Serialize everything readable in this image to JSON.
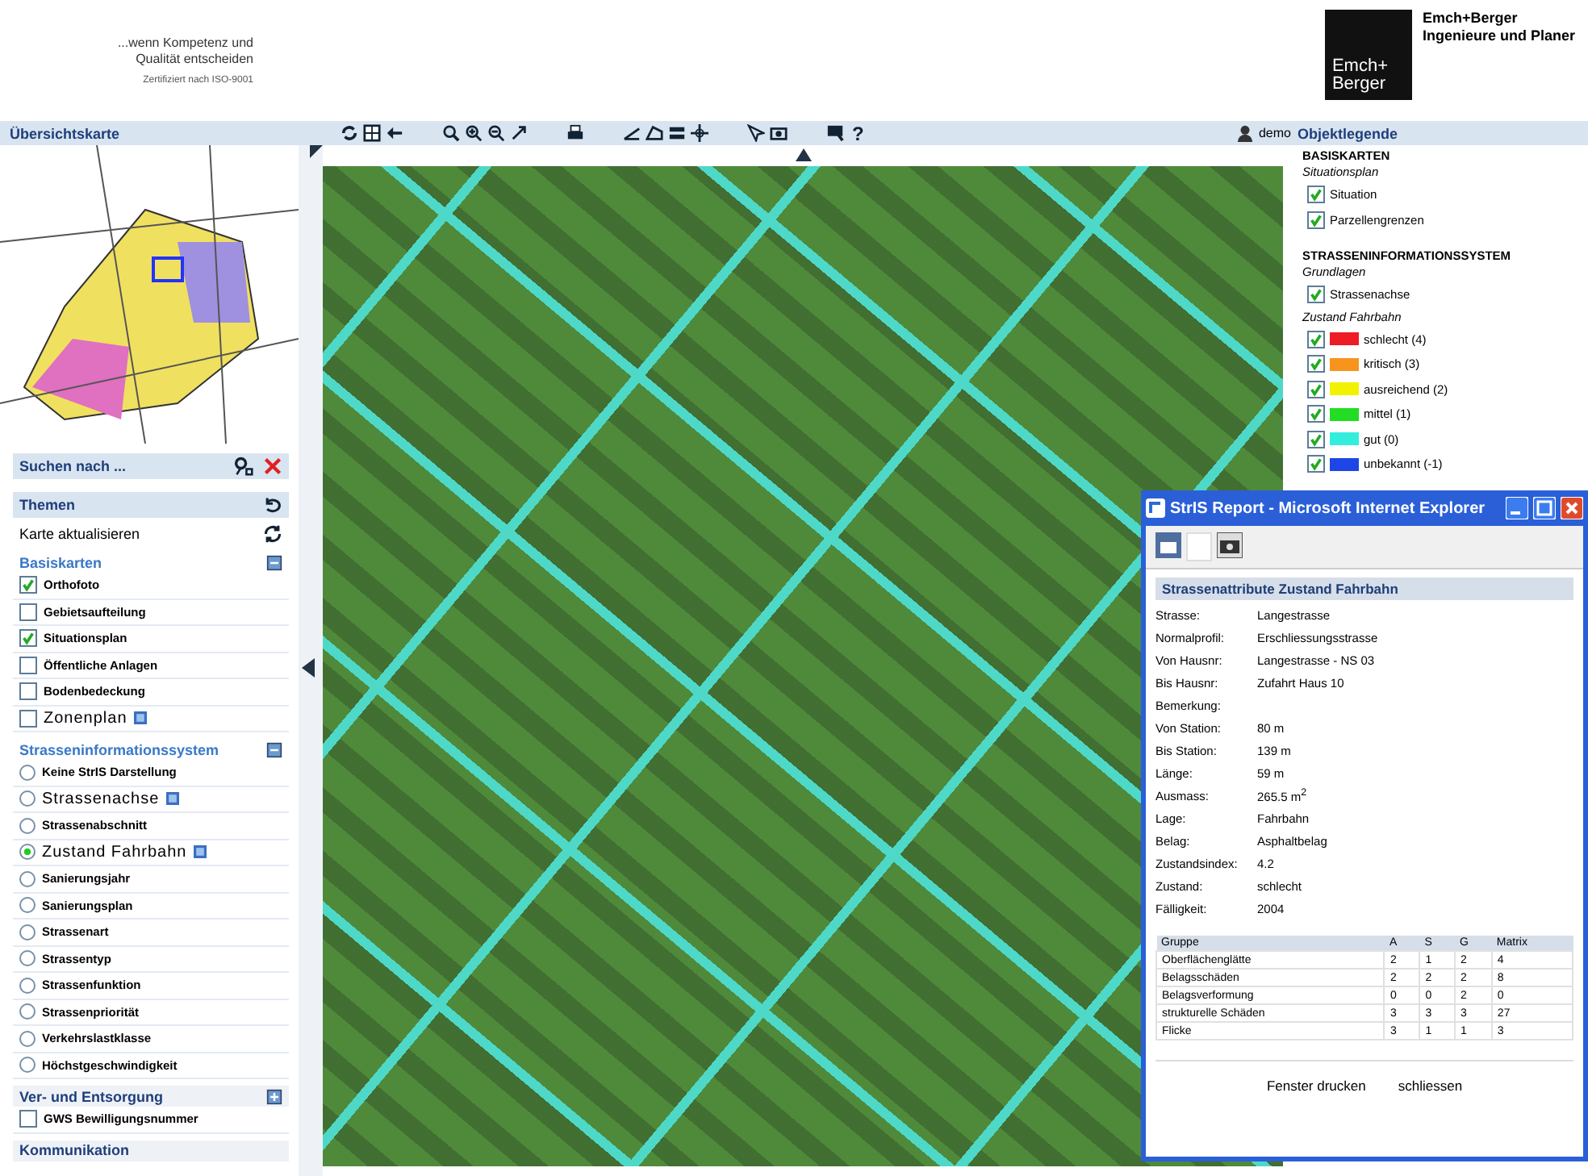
{
  "header": {
    "tagline": [
      "...wenn Kompetenz und",
      "Qualität entscheiden"
    ],
    "certificate": "Zertifiziert nach ISO-9001",
    "logo_text": [
      "Emch+",
      "Berger"
    ],
    "company": [
      "Emch+Berger",
      "Ingenieure und Planer"
    ]
  },
  "toolbar": {
    "left_title": "Übersichtskarte",
    "help": "?",
    "user": "demo",
    "right_title": "Objektlegende"
  },
  "sidebar": {
    "search_label": "Suchen nach ...",
    "themes_title": "Themen",
    "refresh_label": "Karte aktualisieren",
    "groups": [
      {
        "title": "Basiskarten",
        "expanded": true,
        "kind": "checkbox",
        "items": [
          {
            "label": "Orthofoto",
            "checked": true,
            "large": false,
            "info": false
          },
          {
            "label": "Gebietsaufteilung",
            "checked": false,
            "large": false,
            "info": false
          },
          {
            "label": "Situationsplan",
            "checked": true,
            "large": false,
            "info": false
          },
          {
            "label": "Öffentliche Anlagen",
            "checked": false,
            "large": false,
            "info": false
          },
          {
            "label": "Bodenbedeckung",
            "checked": false,
            "large": false,
            "info": false
          },
          {
            "label": "Zonenplan",
            "checked": false,
            "large": true,
            "info": true
          }
        ]
      },
      {
        "title": "Strasseninformationssystem",
        "expanded": true,
        "kind": "radio",
        "items": [
          {
            "label": "Keine StrIS Darstellung",
            "selected": false,
            "large": false,
            "info": false
          },
          {
            "label": "Strassenachse",
            "selected": false,
            "large": true,
            "info": true
          },
          {
            "label": "Strassenabschnitt",
            "selected": false,
            "large": false,
            "info": false
          },
          {
            "label": "Zustand Fahrbahn",
            "selected": true,
            "large": true,
            "info": true
          },
          {
            "label": "Sanierungsjahr",
            "selected": false,
            "large": false,
            "info": false
          },
          {
            "label": "Sanierungsplan",
            "selected": false,
            "large": false,
            "info": false
          },
          {
            "label": "Strassenart",
            "selected": false,
            "large": false,
            "info": false
          },
          {
            "label": "Strassentyp",
            "selected": false,
            "large": false,
            "info": false
          },
          {
            "label": "Strassenfunktion",
            "selected": false,
            "large": false,
            "info": false
          },
          {
            "label": "Strassenpriorität",
            "selected": false,
            "large": false,
            "info": false
          },
          {
            "label": "Verkehrslastklasse",
            "selected": false,
            "large": false,
            "info": false
          },
          {
            "label": "Höchstgeschwindigkeit",
            "selected": false,
            "large": false,
            "info": false
          }
        ]
      },
      {
        "title": "Ver- und Entsorgung",
        "expanded": false,
        "kind": "checkbox",
        "items": [
          {
            "label": "GWS Bewilligungsnummer",
            "checked": false,
            "large": false,
            "info": false
          }
        ]
      },
      {
        "title": "Kommunikation",
        "expanded": false,
        "kind": "none"
      }
    ]
  },
  "legend": {
    "sections": [
      {
        "title": "BASISKARTEN",
        "groups": [
          {
            "title": "Situationsplan",
            "items": [
              {
                "label": "Situation",
                "checked": true
              },
              {
                "label": "Parzellengrenzen",
                "checked": true
              }
            ]
          }
        ]
      },
      {
        "title": "STRASSENINFORMATIONSSYSTEM",
        "groups": [
          {
            "title": "Grundlagen",
            "items": [
              {
                "label": "Strassenachse",
                "checked": true
              }
            ]
          },
          {
            "title": "Zustand Fahrbahn",
            "items": [
              {
                "label": "schlecht (4)",
                "checked": true,
                "color": "#ee1c24"
              },
              {
                "label": "kritisch (3)",
                "checked": true,
                "color": "#f7941d"
              },
              {
                "label": "ausreichend (2)",
                "checked": true,
                "color": "#f2f200"
              },
              {
                "label": "mittel (1)",
                "checked": true,
                "color": "#22dd22"
              },
              {
                "label": "gut (0)",
                "checked": true,
                "color": "#33eedd"
              },
              {
                "label": "unbekannt (-1)",
                "checked": true,
                "color": "#1e46e6"
              }
            ]
          }
        ]
      }
    ]
  },
  "report": {
    "title": "StrIS Report - Microsoft Internet Explorer",
    "heading": "Strassenattribute Zustand Fahrbahn",
    "fields": [
      {
        "label": "Strasse:",
        "value": "Langestrasse"
      },
      {
        "label": "Normalprofil:",
        "value": "Erschliessungsstrasse"
      },
      {
        "label": "Von Hausnr:",
        "value": "Langestrasse - NS 03"
      },
      {
        "label": "Bis Hausnr:",
        "value": "Zufahrt Haus 10"
      },
      {
        "label": "Bemerkung:"
      },
      {
        "label": "Von Station:",
        "value": "80 m"
      },
      {
        "label": "Bis Station:",
        "value": "139 m"
      },
      {
        "label": "Länge:",
        "value": "59 m"
      },
      {
        "label": "Ausmass:",
        "value": "265.5 m$^{2}$"
      },
      {
        "label": "Lage:",
        "value": "Fahrbahn"
      },
      {
        "label": "Belag:",
        "value": "Asphaltbelag"
      },
      {
        "label": "Zustandsindex:",
        "value": "4.2"
      },
      {
        "label": "Zustand:",
        "value": "schlecht"
      },
      {
        "label": "Fälligkeit:",
        "value": "2004"
      }
    ],
    "table": {
      "columns": [
        "Gruppe",
        "A",
        "S",
        "G",
        "Matrix"
      ],
      "rows": [
        [
          "Oberflächenglätte",
          "2",
          "1",
          "2",
          "4"
        ],
        [
          "Belagsschäden",
          "2",
          "2",
          "2",
          "8"
        ],
        [
          "Belagsverformung",
          "0",
          "0",
          "2",
          "0"
        ],
        [
          "strukturelle Schäden",
          "3",
          "3",
          "3",
          "27"
        ],
        [
          "Flicke",
          "3",
          "1",
          "1",
          "3"
        ]
      ]
    },
    "buttons": [
      "Fenster drucken",
      "schliessen"
    ]
  }
}
